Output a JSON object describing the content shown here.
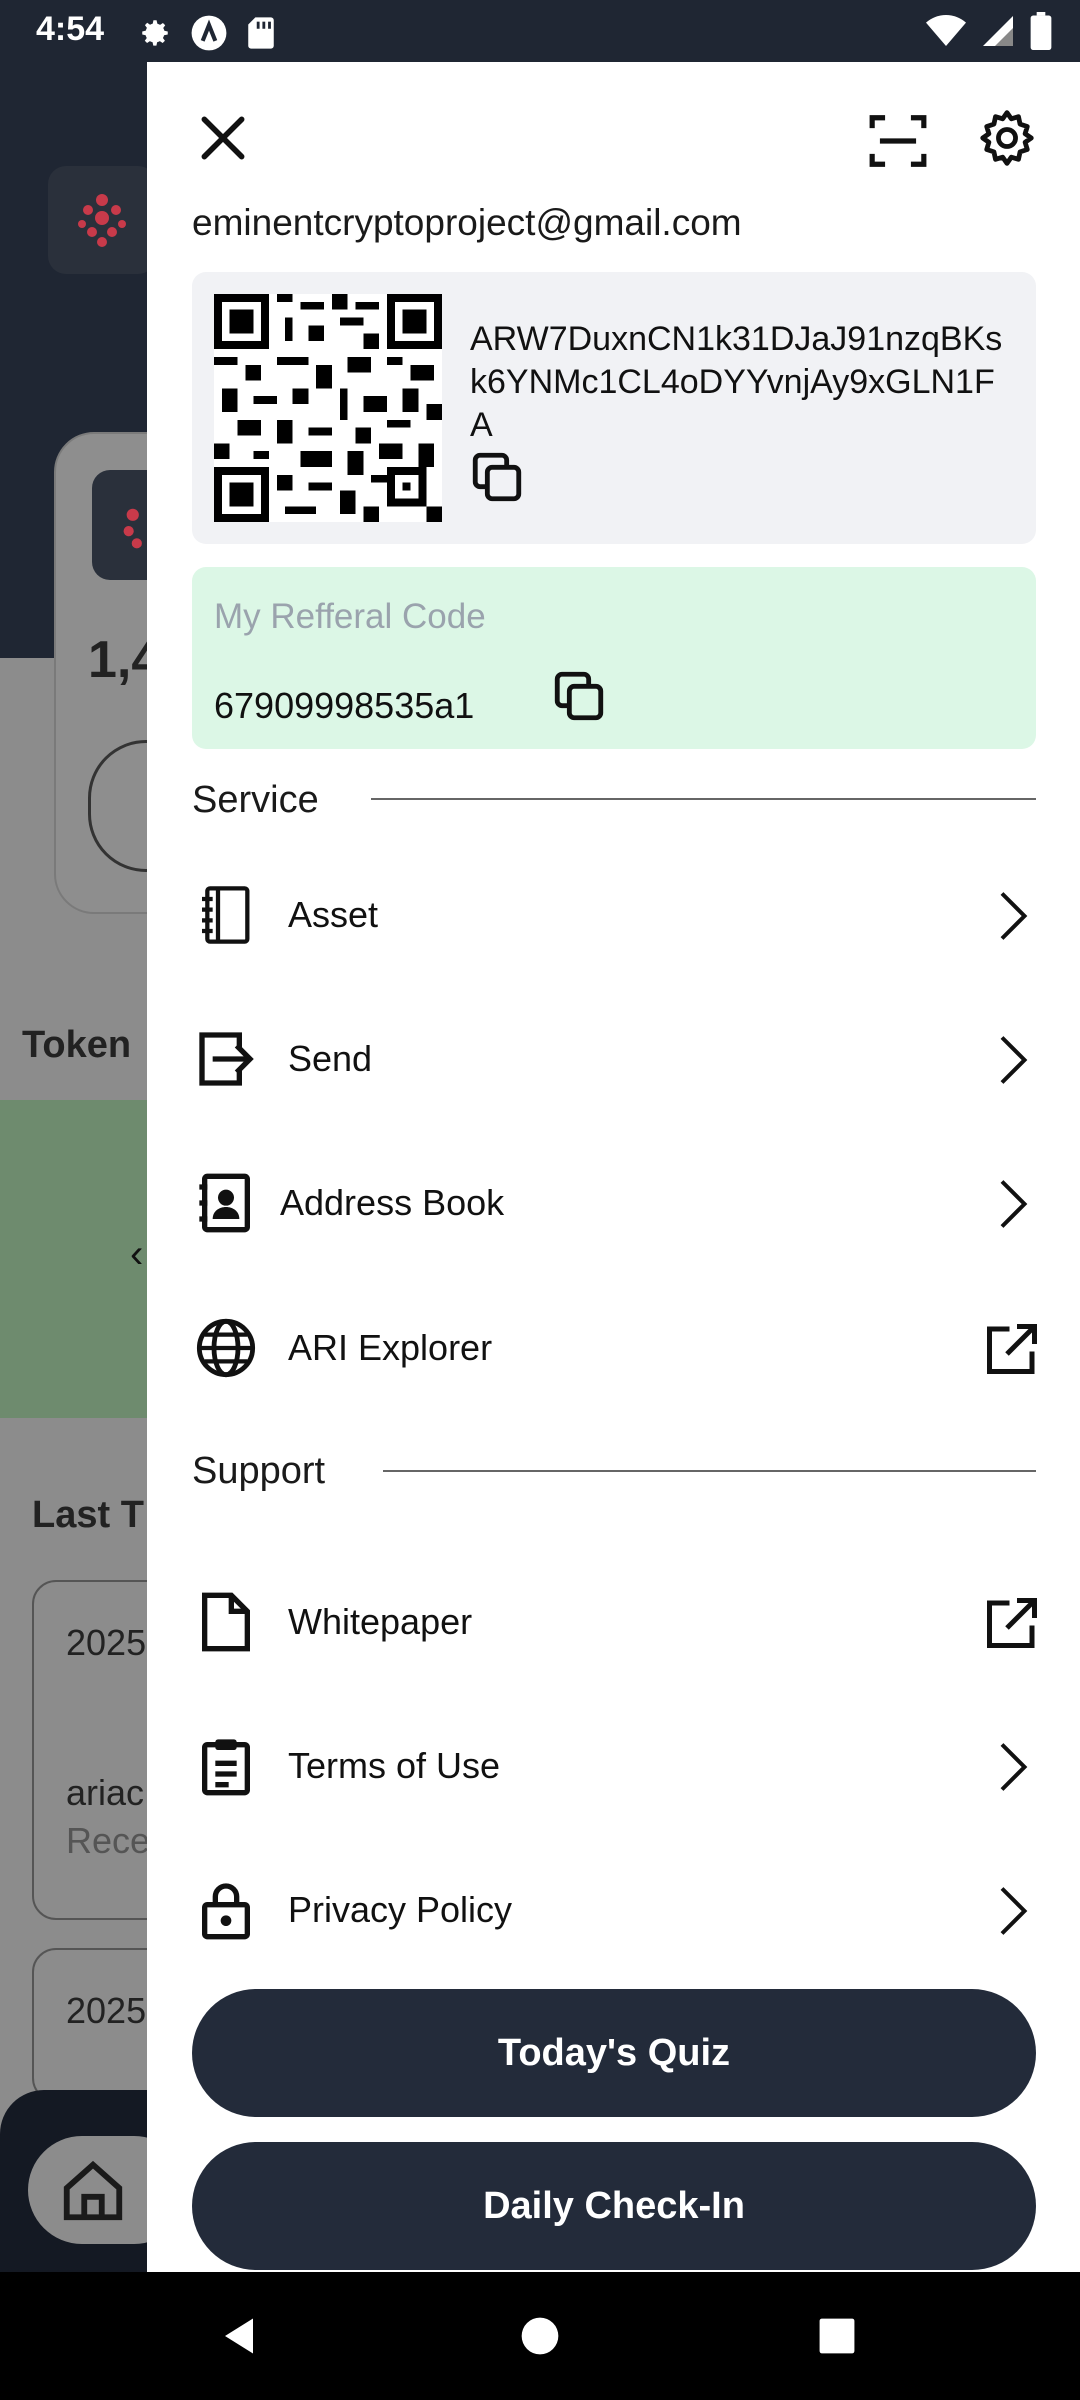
{
  "status_bar": {
    "time": "4:54",
    "icons": [
      "settings-icon",
      "app-a-icon",
      "sd-card-icon",
      "wifi-icon",
      "signal-icon",
      "battery-icon"
    ]
  },
  "background_app": {
    "balance_partial": "1,4",
    "token_label": "Token",
    "last_transactions_partial": "Last T",
    "tx_items": [
      {
        "date_partial": "2025",
        "from_partial": "ariac",
        "type_partial": "Rece"
      },
      {
        "date_partial": "2025"
      }
    ]
  },
  "drawer": {
    "email": "eminentcryptoproject@gmail.com",
    "wallet_address": "ARW7DuxnCN1k31DJaJ91nzqBKsk6YNMc1CL4oDYYvnjAy9xGLN1FA",
    "referral": {
      "label": "My Refferal Code",
      "code": "67909998535a1"
    },
    "service": {
      "title": "Service",
      "items": [
        {
          "label": "Asset",
          "icon": "notebook-icon",
          "trail": "chevron-right-icon"
        },
        {
          "label": "Send",
          "icon": "send-arrow-icon",
          "trail": "chevron-right-icon"
        },
        {
          "label": "Address Book",
          "icon": "address-book-icon",
          "trail": "chevron-right-icon"
        },
        {
          "label": "ARI Explorer",
          "icon": "globe-icon",
          "trail": "external-link-icon"
        }
      ]
    },
    "support": {
      "title": "Support",
      "items": [
        {
          "label": "Whitepaper",
          "icon": "document-icon",
          "trail": "external-link-icon"
        },
        {
          "label": "Terms of Use",
          "icon": "clipboard-icon",
          "trail": "chevron-right-icon"
        },
        {
          "label": "Privacy Policy",
          "icon": "lock-icon",
          "trail": "chevron-right-icon"
        }
      ]
    },
    "buttons": {
      "quiz": "Today's Quiz",
      "checkin": "Daily Check-In"
    }
  },
  "colors": {
    "dark_navy": "#232b3a",
    "referral_bg": "#dcf7e6",
    "address_bg": "#f1f2f5",
    "brand_accent": "#c83a4a"
  }
}
